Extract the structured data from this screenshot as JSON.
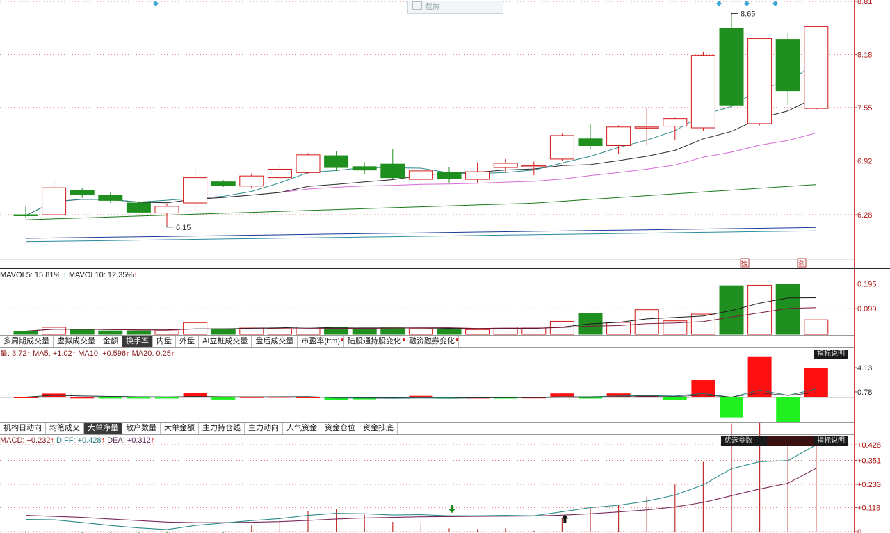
{
  "price_axis": [
    "8.81",
    "8.18",
    "7.55",
    "6.92",
    "6.28"
  ],
  "annotations": {
    "high": "8.65",
    "low": "6.15"
  },
  "markers": [
    "榜",
    "涨"
  ],
  "screenshot_button": "截屏",
  "volume": {
    "label_mavol5": "MAVOL5: 15.81%",
    "label_mavol10": "MAVOL10: 12.35%",
    "axis": [
      "0.195",
      "0.099"
    ]
  },
  "tabs1": [
    {
      "label": "多周期成交量",
      "selected": false,
      "dot": false
    },
    {
      "label": "虚拟成交量",
      "selected": false,
      "dot": false
    },
    {
      "label": "金额",
      "selected": false,
      "dot": false
    },
    {
      "label": "换手率",
      "selected": true,
      "dot": false
    },
    {
      "label": "内盘",
      "selected": false,
      "dot": false
    },
    {
      "label": "外盘",
      "selected": false,
      "dot": false
    },
    {
      "label": "AI立桩成交量",
      "selected": false,
      "dot": false
    },
    {
      "label": "盘后成交量",
      "selected": false,
      "dot": false
    },
    {
      "label": "市盈率(ttm)",
      "selected": false,
      "dot": true
    },
    {
      "label": "陆股通持股变化",
      "selected": false,
      "dot": true
    },
    {
      "label": "融资融券变化",
      "selected": false,
      "dot": true
    }
  ],
  "netvol": {
    "label_l": "量: 3.72",
    "label_ma5": "MA5: +1.02",
    "label_ma10": "MA10: +0.596",
    "label_ma20": "MA20: 0.25",
    "axis": [
      "4.13",
      "0.78"
    ],
    "button": "指标说明"
  },
  "tabs2": [
    {
      "label": "机构日动向",
      "selected": false,
      "dot": false
    },
    {
      "label": "均笔成交",
      "selected": false,
      "dot": false
    },
    {
      "label": "大单净量",
      "selected": true,
      "dot": false
    },
    {
      "label": "散户数量",
      "selected": false,
      "dot": false
    },
    {
      "label": "大单金额",
      "selected": false,
      "dot": false
    },
    {
      "label": "主力持仓线",
      "selected": false,
      "dot": false
    },
    {
      "label": "主力动向",
      "selected": false,
      "dot": false
    },
    {
      "label": "人气资金",
      "selected": false,
      "dot": false
    },
    {
      "label": "资金仓位",
      "selected": false,
      "dot": false
    },
    {
      "label": "资金抄底",
      "selected": false,
      "dot": false
    }
  ],
  "macd": {
    "label_macd": "MACD: +0.232",
    "label_diff": "DIFF: +0.428",
    "label_dea": "DEA: +0.312",
    "axis": [
      "+0.428",
      "+0.351",
      "+0.233",
      "+0.118",
      "0"
    ],
    "buttons": [
      "优选参数",
      "",
      "指标说明"
    ]
  },
  "colors": {
    "up": "#d41818",
    "down": "#1f8f1f",
    "grid": "#d04040",
    "ma5": "#2a8a8a",
    "ma10": "#2a2a2a",
    "ma20": "#d66ad6",
    "ma60": "#1a7a1a"
  },
  "chart_data": {
    "type": "candlestick",
    "y_axis_ticks": [
      8.81,
      8.18,
      7.55,
      6.92,
      6.28
    ],
    "candles": [
      {
        "o": 6.28,
        "h": 6.38,
        "l": 6.24,
        "c": 6.27
      },
      {
        "o": 6.28,
        "h": 6.7,
        "l": 6.27,
        "c": 6.6
      },
      {
        "o": 6.57,
        "h": 6.6,
        "l": 6.48,
        "c": 6.52
      },
      {
        "o": 6.51,
        "h": 6.55,
        "l": 6.42,
        "c": 6.45
      },
      {
        "o": 6.42,
        "h": 6.44,
        "l": 6.3,
        "c": 6.31
      },
      {
        "o": 6.3,
        "h": 6.41,
        "l": 6.15,
        "c": 6.38
      },
      {
        "o": 6.42,
        "h": 6.82,
        "l": 6.3,
        "c": 6.72
      },
      {
        "o": 6.67,
        "h": 6.69,
        "l": 6.61,
        "c": 6.63
      },
      {
        "o": 6.62,
        "h": 6.77,
        "l": 6.6,
        "c": 6.74
      },
      {
        "o": 6.72,
        "h": 6.86,
        "l": 6.7,
        "c": 6.82
      },
      {
        "o": 6.78,
        "h": 7.01,
        "l": 6.76,
        "c": 6.99
      },
      {
        "o": 6.98,
        "h": 7.03,
        "l": 6.8,
        "c": 6.84
      },
      {
        "o": 6.85,
        "h": 6.9,
        "l": 6.76,
        "c": 6.81
      },
      {
        "o": 6.88,
        "h": 7.06,
        "l": 6.7,
        "c": 6.72
      },
      {
        "o": 6.7,
        "h": 6.84,
        "l": 6.58,
        "c": 6.8
      },
      {
        "o": 6.78,
        "h": 6.84,
        "l": 6.66,
        "c": 6.71
      },
      {
        "o": 6.7,
        "h": 6.9,
        "l": 6.66,
        "c": 6.79
      },
      {
        "o": 6.84,
        "h": 6.94,
        "l": 6.79,
        "c": 6.89
      },
      {
        "o": 6.86,
        "h": 6.91,
        "l": 6.75,
        "c": 6.86
      },
      {
        "o": 6.94,
        "h": 7.24,
        "l": 6.92,
        "c": 7.22
      },
      {
        "o": 7.18,
        "h": 7.36,
        "l": 7.06,
        "c": 7.1
      },
      {
        "o": 7.1,
        "h": 7.34,
        "l": 7.0,
        "c": 7.32
      },
      {
        "o": 7.32,
        "h": 7.55,
        "l": 7.1,
        "c": 7.32
      },
      {
        "o": 7.33,
        "h": 7.43,
        "l": 7.16,
        "c": 7.42
      },
      {
        "o": 7.31,
        "h": 8.21,
        "l": 7.27,
        "c": 8.17
      },
      {
        "o": 8.49,
        "h": 8.65,
        "l": 7.56,
        "c": 7.58
      },
      {
        "o": 7.36,
        "h": 8.37,
        "l": 7.34,
        "c": 8.37
      },
      {
        "o": 8.36,
        "h": 8.43,
        "l": 7.58,
        "c": 7.75
      },
      {
        "o": 7.54,
        "h": 8.51,
        "l": 7.52,
        "c": 8.51
      }
    ],
    "turnover": [
      0.012,
      0.027,
      0.02,
      0.013,
      0.013,
      0.013,
      0.045,
      0.021,
      0.024,
      0.022,
      0.028,
      0.026,
      0.022,
      0.025,
      0.021,
      0.02,
      0.018,
      0.028,
      0.024,
      0.05,
      0.082,
      0.046,
      0.095,
      0.052,
      0.078,
      0.188,
      0.19,
      0.195,
      0.056
    ],
    "net_volume": [
      0.05,
      0.54,
      0.02,
      -0.04,
      -0.08,
      -0.06,
      0.66,
      -0.28,
      0.07,
      0.1,
      0.05,
      -0.3,
      -0.25,
      -0.12,
      0.22,
      -0.1,
      0.01,
      -0.04,
      0.03,
      0.56,
      -0.08,
      0.56,
      0.28,
      -0.35,
      2.4,
      -2.75,
      5.6,
      -3.46,
      4.1
    ],
    "macd_diff": [
      0.06,
      0.058,
      0.045,
      0.03,
      0.018,
      0.01,
      0.03,
      0.042,
      0.054,
      0.064,
      0.08,
      0.09,
      0.088,
      0.082,
      0.084,
      0.078,
      0.078,
      0.08,
      0.078,
      0.098,
      0.118,
      0.13,
      0.15,
      0.18,
      0.23,
      0.31,
      0.345,
      0.35,
      0.428
    ],
    "macd_dea": [
      0.08,
      0.075,
      0.07,
      0.062,
      0.054,
      0.047,
      0.044,
      0.044,
      0.046,
      0.049,
      0.055,
      0.062,
      0.067,
      0.07,
      0.073,
      0.074,
      0.075,
      0.076,
      0.077,
      0.081,
      0.088,
      0.097,
      0.107,
      0.122,
      0.144,
      0.177,
      0.21,
      0.238,
      0.312
    ],
    "macd_hist": [
      -0.04,
      -0.034,
      -0.05,
      -0.064,
      -0.072,
      -0.074,
      -0.028,
      -0.004,
      0.016,
      0.03,
      0.05,
      0.056,
      0.042,
      0.024,
      0.022,
      0.008,
      0.006,
      0.008,
      0.002,
      0.034,
      0.06,
      0.066,
      0.086,
      0.116,
      0.172,
      0.266,
      0.27,
      0.224,
      0.232
    ]
  }
}
